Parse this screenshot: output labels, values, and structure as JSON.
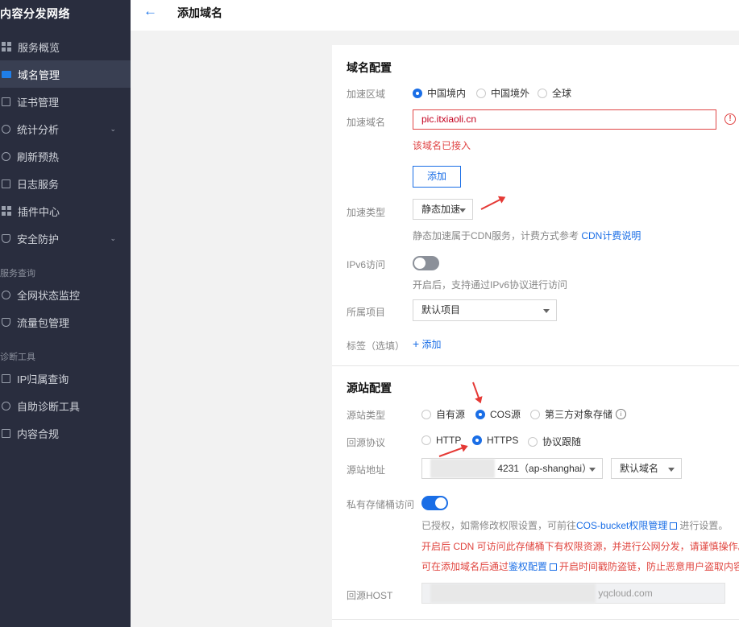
{
  "sidebar": {
    "brand": "内容分发网络",
    "items": [
      {
        "label": "服务概览"
      },
      {
        "label": "域名管理"
      },
      {
        "label": "证书管理"
      },
      {
        "label": "统计分析",
        "chevron": "⌄"
      },
      {
        "label": "刷新预热"
      },
      {
        "label": "日志服务"
      },
      {
        "label": "插件中心"
      },
      {
        "label": "安全防护",
        "chevron": "⌄"
      }
    ],
    "group1": "服务查询",
    "group1_items": [
      {
        "label": "全网状态监控"
      },
      {
        "label": "流量包管理"
      }
    ],
    "group2": "诊断工具",
    "group2_items": [
      {
        "label": "IP归属查询"
      },
      {
        "label": "自助诊断工具"
      },
      {
        "label": "内容合规"
      }
    ]
  },
  "header": {
    "back_icon": "←",
    "title": "添加域名"
  },
  "domain": {
    "section_title": "域名配置",
    "region_label": "加速区域",
    "region_options": [
      "中国境内",
      "中国境外",
      "全球"
    ],
    "region_selected": "中国境内",
    "domain_label": "加速域名",
    "domain_value": "pic.itxiaoli.cn",
    "domain_error": "该域名已接入",
    "add_button": "添加",
    "type_label": "加速类型",
    "type_value": "静态加速",
    "type_hint": "静态加速属于CDN服务，计费方式参考",
    "type_hint_link": "CDN计费说明",
    "ipv6_label": "IPv6访问",
    "ipv6_hint": "开启后，支持通过IPv6协议进行访问",
    "project_label": "所属项目",
    "project_value": "默认项目",
    "tag_label": "标签（选填）",
    "tag_add": "添加"
  },
  "origin": {
    "section_title": "源站配置",
    "type_label": "源站类型",
    "type_options": [
      "自有源",
      "COS源",
      "第三方对象存储"
    ],
    "type_selected": "COS源",
    "protocol_label": "回源协议",
    "protocol_options": [
      "HTTP",
      "HTTPS",
      "协议跟随"
    ],
    "protocol_selected": "HTTPS",
    "address_label": "源站地址",
    "address_value": "4231（ap-shanghai）",
    "address_domain": "默认域名",
    "private_label": "私有存储桶访问",
    "private_hint": "已授权，如需修改权限设置，可前往",
    "private_hint_link": "COS-bucket权限管理",
    "private_hint_end": "进行设置。",
    "warn1": "开启后 CDN 可访问此存储桶下有权限资源，并进行公网分发，请谨慎操作。",
    "warn2_pre": "可在添加域名后通过",
    "warn2_link": "鉴权配置",
    "warn2_post": "开启时间戳防盗链，防止恶意用户盗取内容。",
    "host_label": "回源HOST",
    "host_value": "yqcloud.com"
  },
  "colors": {
    "accent": "#1a6ee6",
    "error": "#e04545",
    "sidebar": "#292d3e"
  }
}
